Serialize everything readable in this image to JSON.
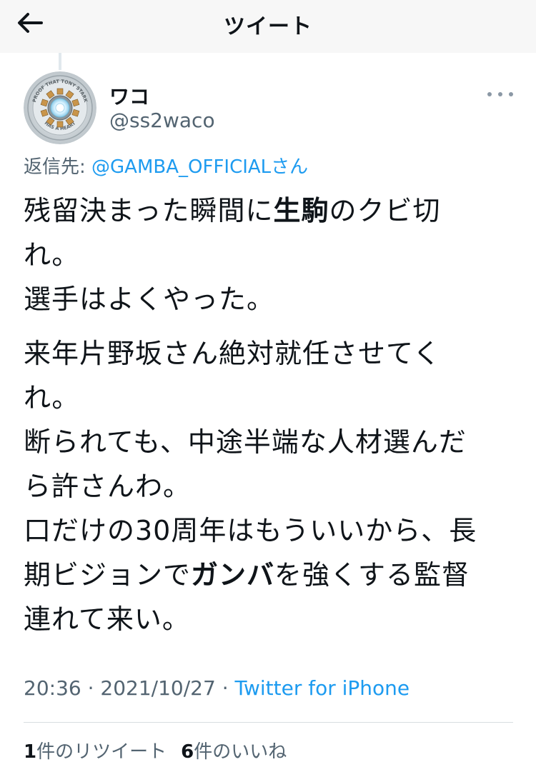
{
  "header": {
    "title": "ツイート"
  },
  "user": {
    "display_name": "ワコ",
    "handle": "@ss2waco",
    "avatar_ring_text_top": "PROOF THAT TONY STARK",
    "avatar_ring_text_bottom": "HAS A HEART"
  },
  "reply": {
    "prefix": "返信先: ",
    "mention": "@GAMBA_OFFICIALさん"
  },
  "tweet": {
    "p1": [
      "残留決まった瞬間に",
      "生駒",
      "のクビ切"
    ],
    "p2": "れ。",
    "p3": "選手はよくやった。",
    "p4": "来年片野坂さん絶対就任させてく",
    "p5": "れ。",
    "p6": "断られても、中途半端な人材選んだ",
    "p7": "ら許さんわ。",
    "p8": "口だけの30周年はもういいから、長",
    "p9": [
      "期ビジョンで",
      "ガンバ",
      "を強くする監督"
    ],
    "p10": "連れて来い。"
  },
  "meta": {
    "time": "20:36",
    "sep1": " · ",
    "date": "2021/10/27",
    "sep2": " · ",
    "source": "Twitter for iPhone"
  },
  "stats": {
    "retweets_count": "1",
    "retweets_label": "件のリツイート",
    "likes_count": "6",
    "likes_label": "件のいいね"
  },
  "colors": {
    "accent": "#1d9bf0",
    "secondary_text": "#536471",
    "header_bg": "#f7f7f7"
  },
  "icons": {
    "back": "arrow-left-icon",
    "more": "more-horizontal-icon"
  }
}
